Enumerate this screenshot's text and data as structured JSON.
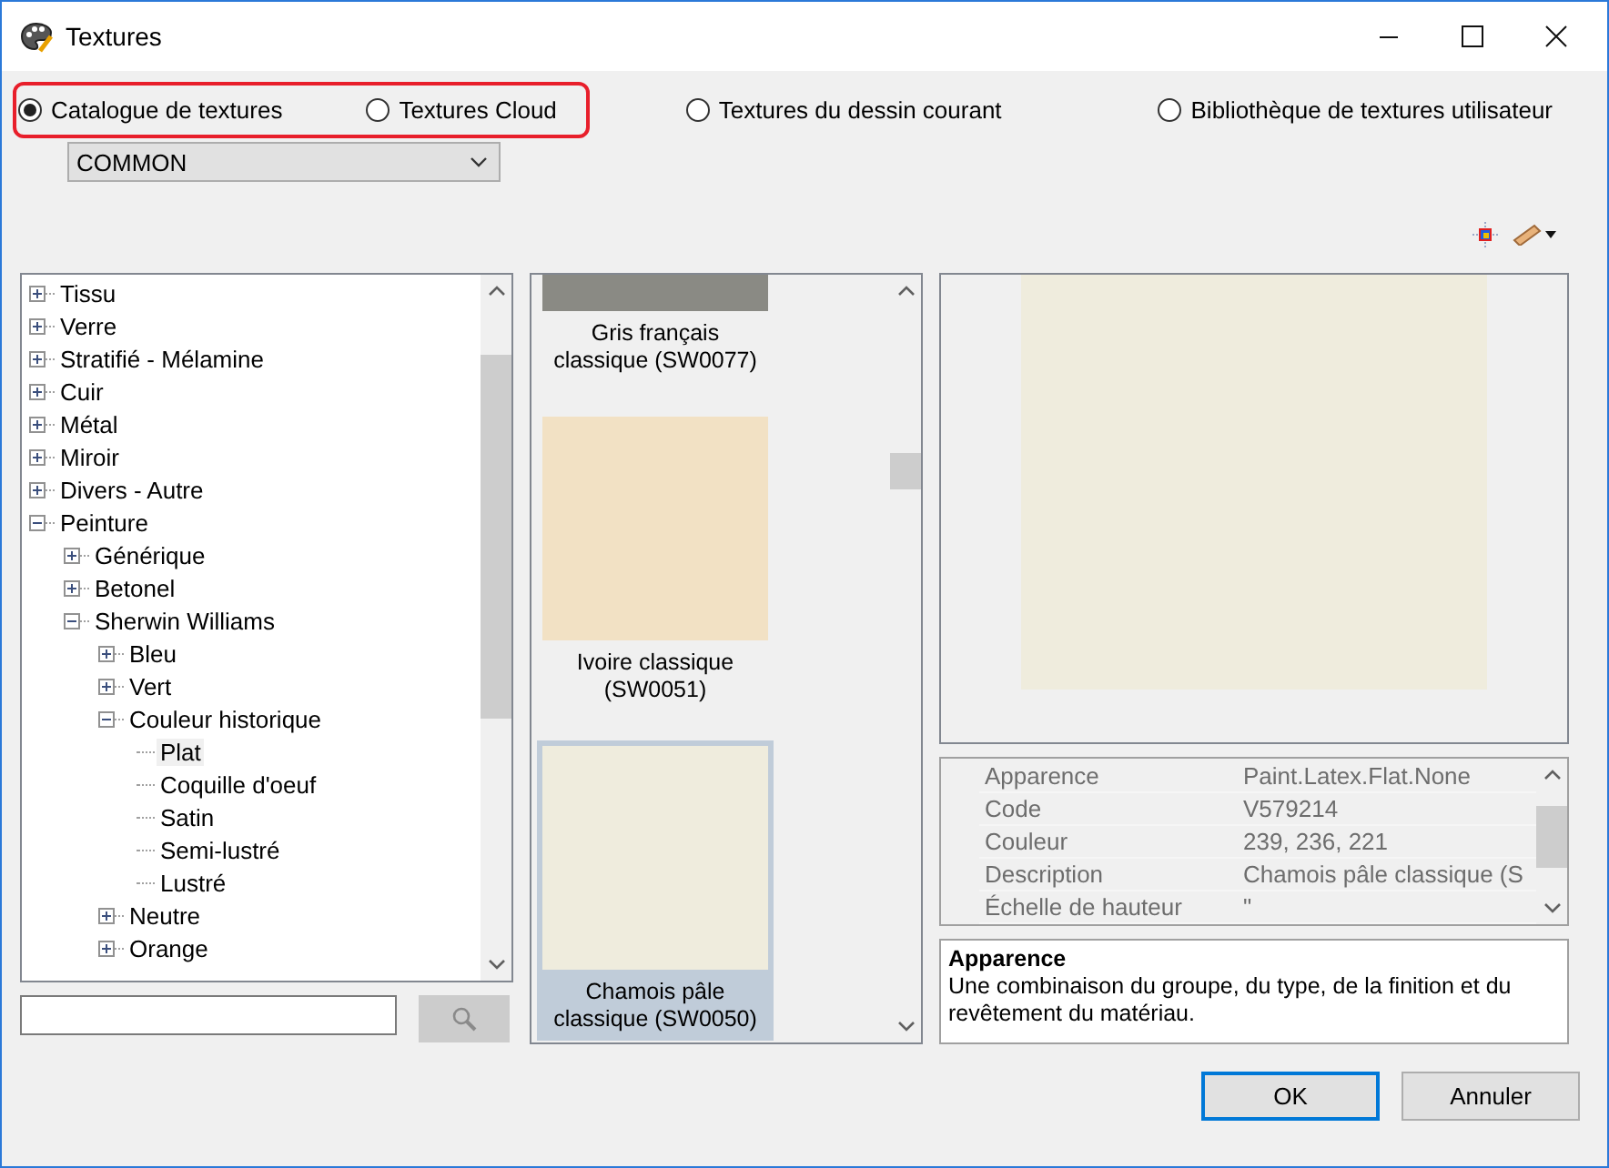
{
  "window": {
    "title": "Textures"
  },
  "sources": [
    {
      "label": "Catalogue de textures",
      "selected": true,
      "highlighted": true
    },
    {
      "label": "Textures Cloud",
      "selected": false,
      "highlighted": true
    },
    {
      "label": "Textures du dessin courant",
      "selected": false,
      "highlighted": false
    },
    {
      "label": "Bibliothèque de textures utilisateur",
      "selected": false,
      "highlighted": false
    }
  ],
  "catalog_dropdown": {
    "value": "COMMON"
  },
  "tree": [
    {
      "label": "Tissu",
      "expanded": false,
      "selected": false
    },
    {
      "label": "Verre",
      "expanded": false,
      "selected": false
    },
    {
      "label": "Stratifié - Mélamine",
      "expanded": false,
      "selected": false
    },
    {
      "label": "Cuir",
      "expanded": false,
      "selected": false
    },
    {
      "label": "Métal",
      "expanded": false,
      "selected": false
    },
    {
      "label": "Miroir",
      "expanded": false,
      "selected": false
    },
    {
      "label": "Divers - Autre",
      "expanded": false,
      "selected": false
    },
    {
      "label": "Peinture",
      "expanded": true,
      "selected": false,
      "children": [
        {
          "label": "Générique",
          "expanded": false,
          "selected": false
        },
        {
          "label": "Betonel",
          "expanded": false,
          "selected": false
        },
        {
          "label": "Sherwin Williams",
          "expanded": true,
          "selected": false,
          "children": [
            {
              "label": "Bleu",
              "expanded": false,
              "selected": false
            },
            {
              "label": "Vert",
              "expanded": false,
              "selected": false
            },
            {
              "label": "Couleur historique",
              "expanded": true,
              "selected": false,
              "children": [
                {
                  "label": "Plat",
                  "selected": true
                },
                {
                  "label": "Coquille d'oeuf",
                  "selected": false
                },
                {
                  "label": "Satin",
                  "selected": false
                },
                {
                  "label": "Semi-lustré",
                  "selected": false
                },
                {
                  "label": "Lustré",
                  "selected": false
                }
              ]
            },
            {
              "label": "Neutre",
              "expanded": false,
              "selected": false
            },
            {
              "label": "Orange",
              "expanded": false,
              "selected": false
            }
          ]
        }
      ]
    }
  ],
  "swatches": [
    {
      "label": "Gris français classique (SW0077)",
      "color": "#8a8a84",
      "selected": false
    },
    {
      "label": "Ivoire classique (SW0051)",
      "color": "#f2e1c4",
      "selected": false
    },
    {
      "label": "Chamois pâle classique (SW0050)",
      "color": "#efecdd",
      "selected": true
    }
  ],
  "properties": [
    {
      "name": "Apparence",
      "value": "Paint.Latex.Flat.None"
    },
    {
      "name": "Code",
      "value": "V579214"
    },
    {
      "name": "Couleur",
      "value": "239, 236, 221"
    },
    {
      "name": "Description",
      "value": "Chamois pâle classique (S"
    },
    {
      "name": "Échelle de hauteur",
      "value": "\""
    }
  ],
  "help": {
    "title": "Apparence",
    "text": "Une combinaison du groupe, du type, de la finition et du revêtement du matériau."
  },
  "buttons": [
    {
      "label": "OK",
      "default": true
    },
    {
      "label": "Annuler",
      "default": false
    }
  ]
}
